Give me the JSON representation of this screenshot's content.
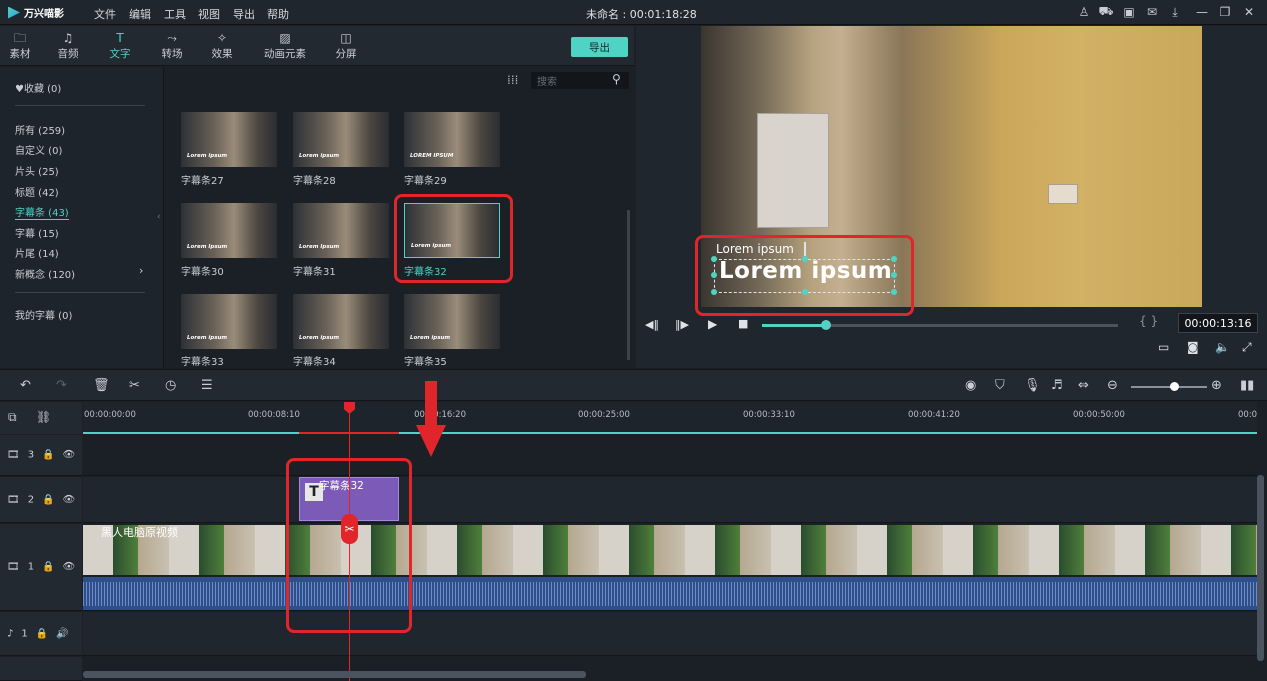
{
  "app": {
    "name": "万兴喵影",
    "menus": [
      "文件",
      "编辑",
      "工具",
      "视图",
      "导出",
      "帮助"
    ],
    "doc_title": "未命名 : 00:01:18:28"
  },
  "lib_tabs": [
    {
      "label": "素材",
      "icon": "folder-icon"
    },
    {
      "label": "音频",
      "icon": "music-note-icon"
    },
    {
      "label": "文字",
      "icon": "text-icon"
    },
    {
      "label": "转场",
      "icon": "transition-icon"
    },
    {
      "label": "效果",
      "icon": "effects-icon"
    },
    {
      "label": "动画元素",
      "icon": "image-icon"
    },
    {
      "label": "分屏",
      "icon": "split-screen-icon"
    }
  ],
  "export_label": "导出",
  "search_placeholder": "搜索",
  "categories": {
    "favorites": "♥收藏 (0)",
    "items": [
      "所有 (259)",
      "自定义 (0)",
      "片头 (25)",
      "标题 (42)",
      "字幕条 (43)",
      "字幕 (15)",
      "片尾 (14)",
      "新概念 (120)"
    ],
    "mine": "我的字幕 (0)"
  },
  "thumbs": [
    {
      "name": "字幕条27",
      "cap": "Lorem ipsum"
    },
    {
      "name": "字幕条28",
      "cap": "Lorem ipsum"
    },
    {
      "name": "字幕条29",
      "cap": "LOREM IPSUM"
    },
    {
      "name": "字幕条30",
      "cap": "Lorem Ipsum"
    },
    {
      "name": "字幕条31",
      "cap": "Lorem Ipsum"
    },
    {
      "name": "字幕条32",
      "cap": "Lorem ipsum"
    },
    {
      "name": "字幕条33",
      "cap": "Lorem ipsum"
    },
    {
      "name": "字幕条34",
      "cap": "Lorem ipsum"
    },
    {
      "name": "字幕条35",
      "cap": "Lorem ipsum"
    }
  ],
  "preview": {
    "line1": "Lorem ipsum",
    "line2": "Lorem ipsum",
    "timecode": "00:00:13:16",
    "brackets": "{ }"
  },
  "ruler": [
    "00:00:00:00",
    "00:00:08:10",
    "00:00:16:20",
    "00:00:25:00",
    "00:00:33:10",
    "00:00:41:20",
    "00:00:50:00",
    "00:0"
  ],
  "tracks": {
    "t3": "3",
    "t2": "2",
    "t1": "1",
    "a1": "1"
  },
  "clip_label": "字幕条32",
  "video_label": "黑人电脑原视频",
  "colors": {
    "accent": "#4fd3c4",
    "highlight": "#e0262b",
    "clip": "#7c5ab8"
  }
}
